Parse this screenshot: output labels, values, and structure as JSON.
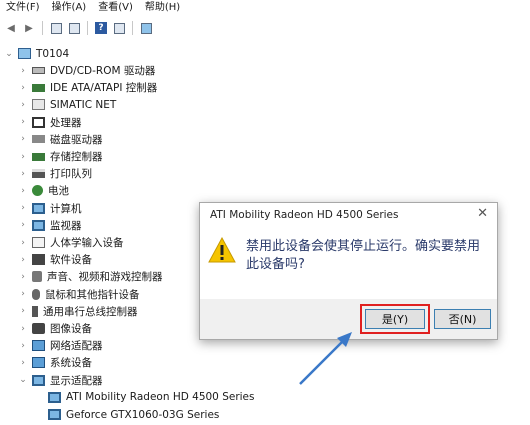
{
  "menu": [
    "文件(F)",
    "操作(A)",
    "查看(V)",
    "帮助(H)"
  ],
  "tree": {
    "root": "T0104",
    "items": [
      {
        "label": "DVD/CD-ROM 驱动器",
        "icon": "disk"
      },
      {
        "label": "IDE ATA/ATAPI 控制器",
        "icon": "chip"
      },
      {
        "label": "SIMATIC NET",
        "icon": "net"
      },
      {
        "label": "处理器",
        "icon": "cpu"
      },
      {
        "label": "磁盘驱动器",
        "icon": "gray"
      },
      {
        "label": "存储控制器",
        "icon": "chip"
      },
      {
        "label": "打印队列",
        "icon": "print"
      },
      {
        "label": "电池",
        "icon": "bat"
      },
      {
        "label": "计算机",
        "icon": "mon"
      },
      {
        "label": "监视器",
        "icon": "mon"
      },
      {
        "label": "人体学输入设备",
        "icon": "hid"
      },
      {
        "label": "软件设备",
        "icon": "sw"
      },
      {
        "label": "声音、视频和游戏控制器",
        "icon": "snd"
      },
      {
        "label": "鼠标和其他指针设备",
        "icon": "mouse"
      },
      {
        "label": "通用串行总线控制器",
        "icon": "usb"
      },
      {
        "label": "图像设备",
        "icon": "cam"
      },
      {
        "label": "网络适配器",
        "icon": "sys"
      },
      {
        "label": "系统设备",
        "icon": "sys"
      },
      {
        "label": "显示适配器",
        "icon": "mon"
      }
    ],
    "display_children": [
      "ATI Mobility Radeon HD 4500 Series",
      "Geforce GTX1060-03G Series"
    ]
  },
  "dialog": {
    "title": "ATI Mobility Radeon HD 4500 Series",
    "close": "✕",
    "message": "禁用此设备会使其停止运行。确实要禁用此设备吗?",
    "yes": "是(Y)",
    "no": "否(N)"
  },
  "colors": {
    "highlight": "#e02020",
    "arrow": "#3a78c8"
  }
}
